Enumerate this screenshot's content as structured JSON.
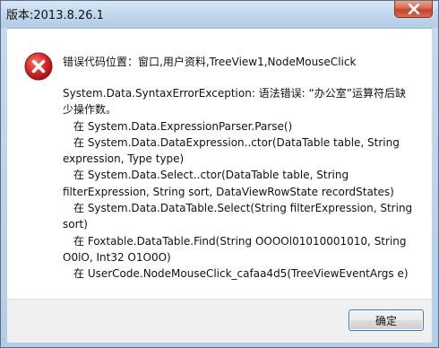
{
  "window": {
    "title": "版本:2013.8.26.1"
  },
  "dialog": {
    "heading": "错误代码位置：窗口,用户资料,TreeView1,NodeMouseClick",
    "message_lines": [
      "System.Data.SyntaxErrorException: 语法错误: “办公室”运算符后缺",
      "少操作数。",
      "在 System.Data.ExpressionParser.Parse()",
      "在 System.Data.DataExpression..ctor(DataTable table, String",
      "expression, Type type)",
      "在 System.Data.Select..ctor(DataTable table, String",
      "filterExpression, String sort, DataViewRowState recordStates)",
      "在 System.Data.DataTable.Select(String filterExpression, String",
      "sort)",
      "在 Foxtable.DataTable.Find(String OOOOl01010001010, String",
      "O0lO, Int32 O1O0O)",
      "在 UserCode.NodeMouseClick_cafaa4d5(TreeViewEventArgs e)"
    ],
    "ok_label": "确定"
  },
  "icons": {
    "error": "error-icon",
    "close": "close-icon"
  },
  "colors": {
    "error_red": "#d42a2a",
    "close_red": "#c2412a",
    "button_border": "#3c7fb1"
  }
}
